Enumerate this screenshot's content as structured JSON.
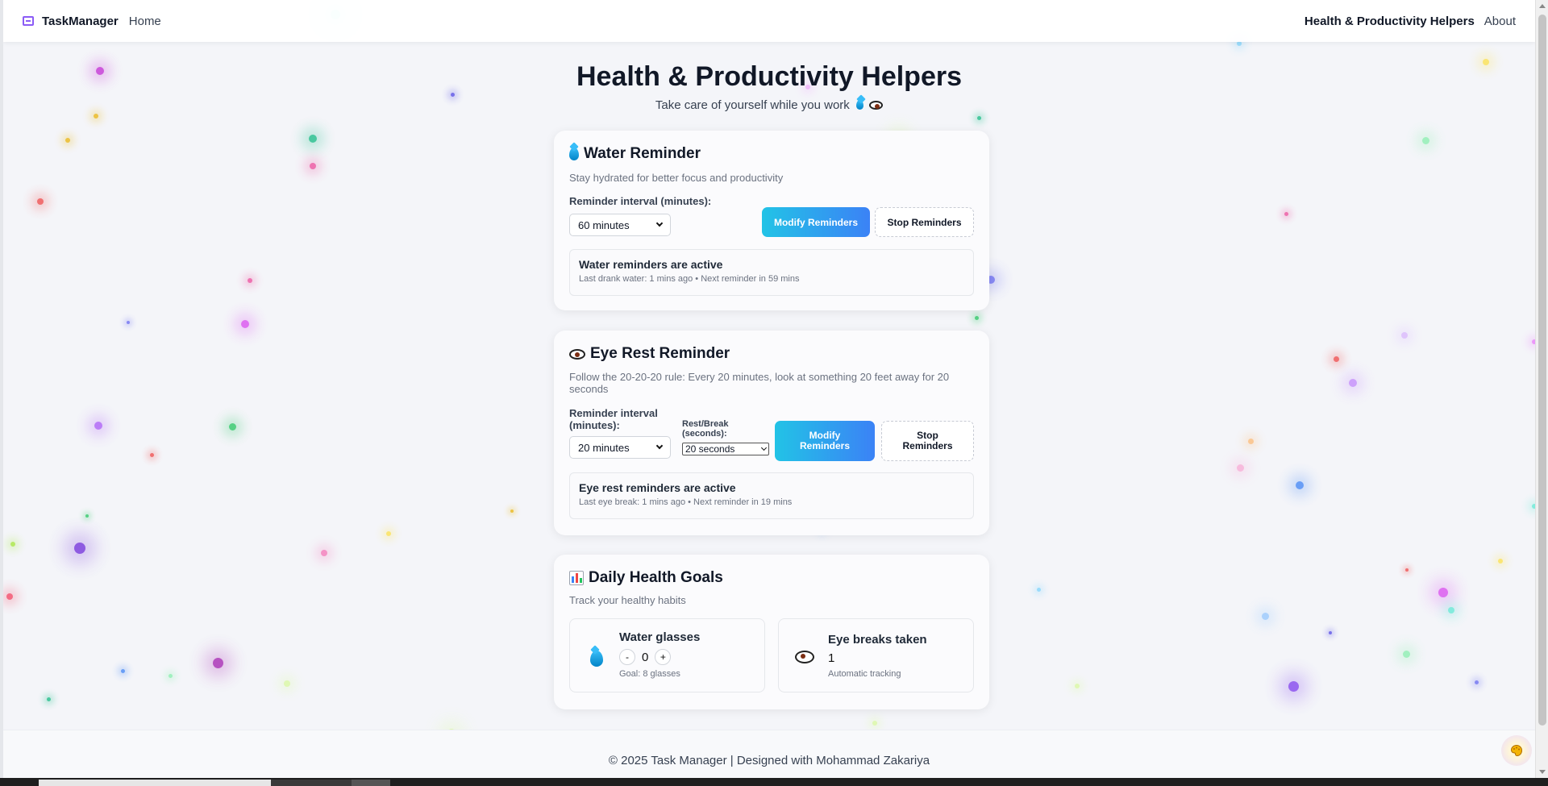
{
  "nav": {
    "brand": "TaskManager",
    "home": "Home",
    "health": "Health & Productivity Helpers",
    "about": "About"
  },
  "header": {
    "title": "Health & Productivity Helpers",
    "subtitle": "Take care of yourself while you work"
  },
  "water": {
    "title": "Water Reminder",
    "description": "Stay hydrated for better focus and productivity",
    "interval_label": "Reminder interval (minutes):",
    "interval_value": "60 minutes",
    "modify_label": "Modify Reminders",
    "stop_label": "Stop Reminders",
    "status_title": "Water reminders are active",
    "status_detail": "Last drank water: 1 mins ago • Next reminder in 59 mins"
  },
  "eye": {
    "title": "Eye Rest Reminder",
    "description": "Follow the 20-20-20 rule: Every 20 minutes, look at something 20 feet away for 20 seconds",
    "interval_label": "Reminder interval (minutes):",
    "interval_value": "20 minutes",
    "rest_label": "Rest/Break (seconds):",
    "rest_value": "20 seconds",
    "modify_label": "Modify Reminders",
    "stop_label": "Stop Reminders",
    "status_title": "Eye rest reminders are active",
    "status_detail": "Last eye break: 1 mins ago • Next reminder in 19 mins"
  },
  "goals": {
    "title": "Daily Health Goals",
    "description": "Track your healthy habits",
    "water_title": "Water glasses",
    "water_count": "0",
    "decrement": "-",
    "increment": "+",
    "water_goal": "Goal: 8 glasses",
    "eye_title": "Eye breaks taken",
    "eye_count": "1",
    "eye_note": "Automatic tracking"
  },
  "footer": {
    "text": "© 2025 Task Manager | Designed with Mohammad Zakariya"
  },
  "icons": {
    "brand": "task-icon",
    "water": "water-drop-icon",
    "eye": "eye-icon",
    "goals": "bar-chart-icon",
    "theme": "palette-icon"
  },
  "colors": {
    "accent_start": "#22c3e6",
    "accent_end": "#3b82f6",
    "brand_icon": "#8b5cf6"
  }
}
